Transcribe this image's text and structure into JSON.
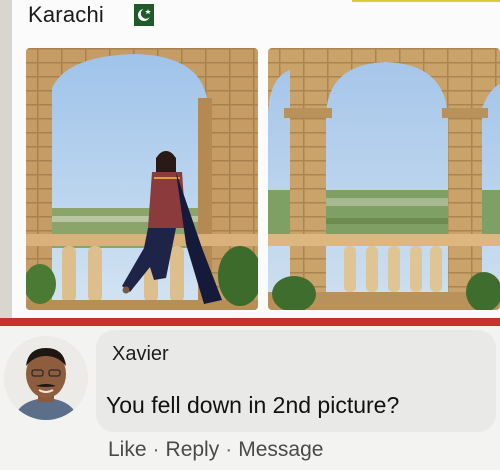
{
  "post": {
    "location": "Karachi",
    "flag_icon": "pakistan-flag-icon",
    "photos": [
      {
        "subject": "woman-seated-on-balustrade"
      },
      {
        "subject": "empty-balustrade"
      }
    ]
  },
  "comment": {
    "author": "Xavier",
    "text": "You fell down in 2nd picture?",
    "actions": {
      "like": "Like",
      "reply": "Reply",
      "message": "Message",
      "separator": "·"
    }
  },
  "colors": {
    "accent_divider": "#c9302c",
    "bubble": "#e9e9e7",
    "sky": "#a9c9ea",
    "stone": "#c9a36a"
  }
}
